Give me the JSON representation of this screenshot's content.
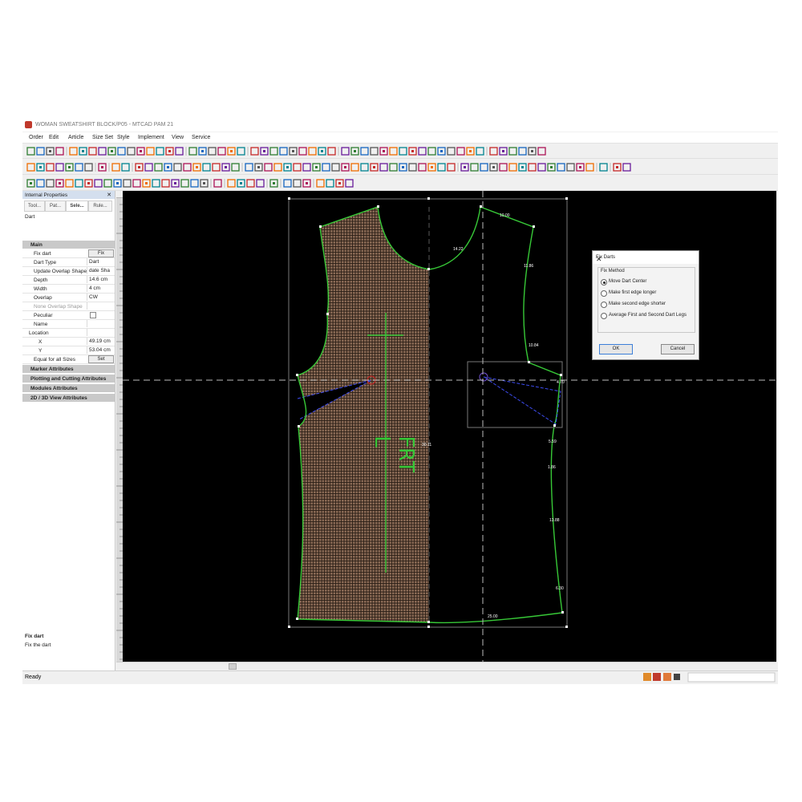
{
  "window": {
    "title": "WOMAN SWEATSHIRT BLOCK/P05 - MTCAD PAM 21"
  },
  "menu": [
    "Order",
    "Edit",
    "Article",
    "Size Set",
    "Style",
    "Implement",
    "View",
    "Service"
  ],
  "properties_panel": {
    "title": "Internal Properties",
    "close": "✕",
    "tabs": [
      "Tool...",
      "Pat...",
      "Sele...",
      "Rule..."
    ],
    "active_tab": 2,
    "object_type": "Dart",
    "main_section": "Main",
    "rows": [
      {
        "key": "Fix dart",
        "value": "Fix",
        "kind": "button"
      },
      {
        "key": "Dart Type",
        "value": "Dart",
        "kind": "value"
      },
      {
        "key": "Update Overlap Shape",
        "value": "date Sha",
        "kind": "value"
      },
      {
        "key": "Depth",
        "value": "14.6 cm",
        "kind": "value"
      },
      {
        "key": "Width",
        "value": "4 cm",
        "kind": "value"
      },
      {
        "key": "Overlap",
        "value": "CW",
        "kind": "value"
      },
      {
        "key": "None Overlap Shape",
        "value": "",
        "kind": "muted"
      },
      {
        "key": "Peculiar",
        "value": "",
        "kind": "checkbox"
      },
      {
        "key": "Name",
        "value": "",
        "kind": "value"
      },
      {
        "key": "Location",
        "value": "",
        "kind": "value"
      },
      {
        "key": "X",
        "value": "49.19 cm",
        "kind": "value"
      },
      {
        "key": "Y",
        "value": "53.04 cm",
        "kind": "value"
      },
      {
        "key": "Equal for all Sizes",
        "value": "Set",
        "kind": "button"
      }
    ],
    "sections": [
      "Marker Attributes",
      "Plotting and Cutting Attributes",
      "Modules Attributes",
      "2D / 3D View Attributes"
    ],
    "footer_title": "Fix dart",
    "footer_desc": "Fix the dart"
  },
  "status": {
    "text": "Ready"
  },
  "canvas": {
    "piece_label": "FRT",
    "piece_size": "L",
    "measurements": [
      "10.00",
      "14.22",
      "11.86",
      "10.84",
      "4.70",
      "5.59",
      "1.86",
      "13.88",
      "6.30",
      "25.00",
      "30.11"
    ]
  },
  "dialog": {
    "title": "Fix Darts",
    "close": "✕",
    "group_label": "Fix Method",
    "options": [
      "Move Dart Center",
      "Make first edge longer",
      "Make second edge shorter",
      "Average First and Second Dart Legs"
    ],
    "selected": 0,
    "ok": "OK",
    "cancel": "Cancel"
  },
  "colors": {
    "accent": "#3c7fd8",
    "outline": "#37c837",
    "canvas": "#000000",
    "fabric": "#8a6a55"
  }
}
